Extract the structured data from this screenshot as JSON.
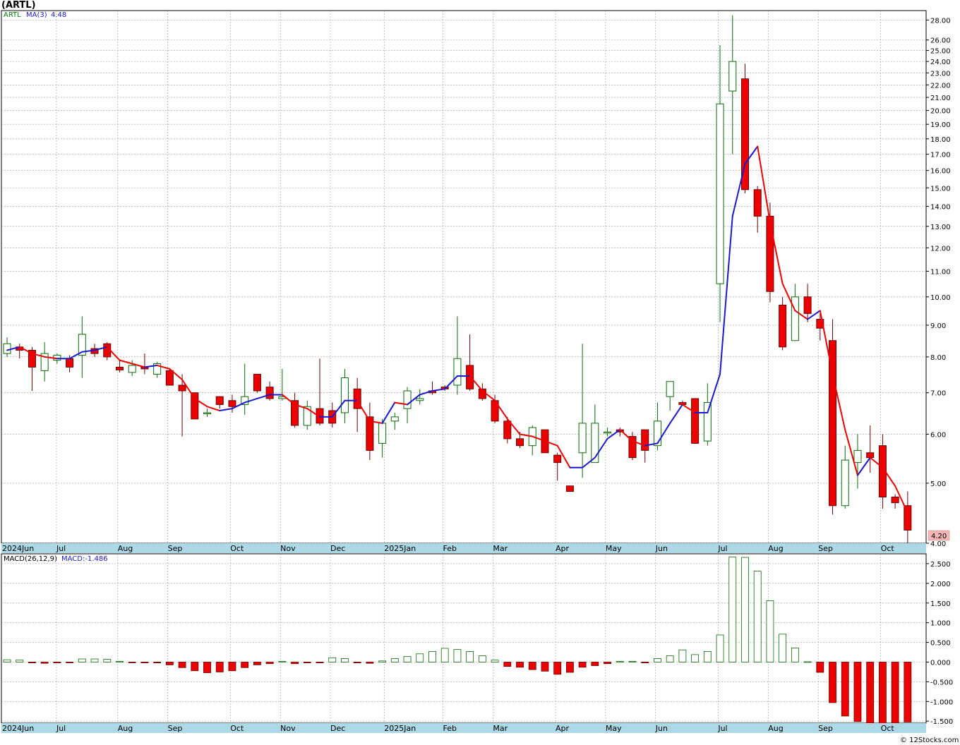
{
  "title": "(ARTL)",
  "legend": {
    "symbol": "ARTL",
    "ma_label": "MA(3)",
    "ma_value": "4.48",
    "macd_label": "MACD(26,12,9)",
    "macd_value_label": "MACD:-1.486"
  },
  "last_price_label": "4.20",
  "footer": "© 12Stocks.com",
  "colors": {
    "up": "#0a6a0a",
    "down_fill": "#ee0000",
    "down_border": "#660000",
    "ma_rising": "#1a1acc",
    "ma_falling": "#ee0000",
    "grid": "#999999",
    "month_bar": "#add8e6",
    "price_tag": "#f4b6b6"
  },
  "chart_data": [
    {
      "type": "candlestick",
      "series_name": "ARTL",
      "scale": "log",
      "ylim": [
        4.0,
        29.0
      ],
      "y_ticks": [
        4.0,
        5.0,
        6.0,
        7.0,
        8.0,
        9.0,
        10.0,
        11.0,
        12.0,
        13.0,
        14.0,
        15.0,
        16.0,
        17.0,
        18.0,
        19.0,
        20.0,
        21.0,
        22.0,
        23.0,
        24.0,
        25.0,
        26.0,
        28.0
      ],
      "y_tick_labels": [
        "4.00",
        "5.00",
        "6.00",
        "7.00",
        "8.00",
        "9.00",
        "10.00",
        "11.00",
        "12.00",
        "13.00",
        "14.00",
        "15.00",
        "16.00",
        "17.00",
        "18.00",
        "19.00",
        "20.00",
        "21.00",
        "22.00",
        "23.00",
        "24.00",
        "25.00",
        "26.00",
        "28.00"
      ],
      "x_labels": [
        {
          "label": "2024Jun",
          "week": 0
        },
        {
          "label": "Jul",
          "week": 4.4
        },
        {
          "label": "Aug",
          "week": 9.3
        },
        {
          "label": "Sep",
          "week": 13.3
        },
        {
          "label": "Oct",
          "week": 18.3
        },
        {
          "label": "Nov",
          "week": 22.3
        },
        {
          "label": "Dec",
          "week": 26.3
        },
        {
          "label": "2025Jan",
          "week": 30.6
        },
        {
          "label": "Feb",
          "week": 35.3
        },
        {
          "label": "Mar",
          "week": 39.3
        },
        {
          "label": "Apr",
          "week": 44.3
        },
        {
          "label": "May",
          "week": 48.3
        },
        {
          "label": "Jun",
          "week": 52.3
        },
        {
          "label": "Jul",
          "week": 57.3
        },
        {
          "label": "Aug",
          "week": 61.3
        },
        {
          "label": "Sep",
          "week": 65.3
        },
        {
          "label": "Oct",
          "week": 70.3
        }
      ],
      "ohlc": [
        [
          8.1,
          8.6,
          8.0,
          8.4
        ],
        [
          8.3,
          8.4,
          7.95,
          8.2
        ],
        [
          8.2,
          8.3,
          7.05,
          7.7
        ],
        [
          7.6,
          8.45,
          7.3,
          8.1
        ],
        [
          7.9,
          8.1,
          7.8,
          8.05
        ],
        [
          7.95,
          8.05,
          7.55,
          7.7
        ],
        [
          8.05,
          9.3,
          7.4,
          8.7
        ],
        [
          8.25,
          8.4,
          8.0,
          8.1
        ],
        [
          8.4,
          8.45,
          7.9,
          8.0
        ],
        [
          7.7,
          7.9,
          7.55,
          7.62
        ],
        [
          7.55,
          7.9,
          7.45,
          7.75
        ],
        [
          7.7,
          8.1,
          7.5,
          7.65
        ],
        [
          7.5,
          7.85,
          7.4,
          7.8
        ],
        [
          7.6,
          7.65,
          7.2,
          7.2
        ],
        [
          7.2,
          7.5,
          5.95,
          7.05
        ],
        [
          7.0,
          7.0,
          6.35,
          6.35
        ],
        [
          6.5,
          6.6,
          6.4,
          6.5
        ],
        [
          6.9,
          6.9,
          6.6,
          6.7
        ],
        [
          6.8,
          6.95,
          6.5,
          6.65
        ],
        [
          6.7,
          7.8,
          6.45,
          6.9
        ],
        [
          7.5,
          7.5,
          7.0,
          7.05
        ],
        [
          7.15,
          7.3,
          6.8,
          6.85
        ],
        [
          6.85,
          7.65,
          6.8,
          6.9
        ],
        [
          6.8,
          7.0,
          6.15,
          6.2
        ],
        [
          6.2,
          6.8,
          6.1,
          6.65
        ],
        [
          6.6,
          7.95,
          6.2,
          6.25
        ],
        [
          6.55,
          6.75,
          6.15,
          6.25
        ],
        [
          6.5,
          7.65,
          6.25,
          7.4
        ],
        [
          7.1,
          7.4,
          6.05,
          6.6
        ],
        [
          6.4,
          6.75,
          5.45,
          5.65
        ],
        [
          5.8,
          6.35,
          5.5,
          6.25
        ],
        [
          6.3,
          6.5,
          6.1,
          6.4
        ],
        [
          6.6,
          7.15,
          6.25,
          7.05
        ],
        [
          6.8,
          7.1,
          6.7,
          6.85
        ],
        [
          7.05,
          7.3,
          6.95,
          7.0
        ],
        [
          7.15,
          7.2,
          7.05,
          7.1
        ],
        [
          7.2,
          9.3,
          6.95,
          7.95
        ],
        [
          7.75,
          8.7,
          7.05,
          7.1
        ],
        [
          7.1,
          7.25,
          6.8,
          6.85
        ],
        [
          6.8,
          6.95,
          6.25,
          6.3
        ],
        [
          6.3,
          6.4,
          5.8,
          5.9
        ],
        [
          5.9,
          6.05,
          5.7,
          5.75
        ],
        [
          5.75,
          6.2,
          5.55,
          6.15
        ],
        [
          6.1,
          6.1,
          5.6,
          5.6
        ],
        [
          5.55,
          5.6,
          5.05,
          5.4
        ],
        [
          4.95,
          4.95,
          4.85,
          4.85
        ],
        [
          5.6,
          8.4,
          5.1,
          6.25
        ],
        [
          5.4,
          6.7,
          5.4,
          6.25
        ],
        [
          6.05,
          6.15,
          5.95,
          6.05
        ],
        [
          6.1,
          6.15,
          5.95,
          6.05
        ],
        [
          5.95,
          6.05,
          5.45,
          5.5
        ],
        [
          6.1,
          6.1,
          5.4,
          5.65
        ],
        [
          5.75,
          6.75,
          5.65,
          6.3
        ],
        [
          6.9,
          7.25,
          6.55,
          7.3
        ],
        [
          6.75,
          6.8,
          6.75,
          6.7
        ],
        [
          6.85,
          6.85,
          5.8,
          5.8
        ],
        [
          5.85,
          7.25,
          5.75,
          6.75
        ],
        [
          10.5,
          25.5,
          9.1,
          20.5
        ],
        [
          21.5,
          28.5,
          17.0,
          24.0
        ],
        [
          22.5,
          23.8,
          14.7,
          14.9
        ],
        [
          14.9,
          15.1,
          12.7,
          13.5
        ],
        [
          13.5,
          14.2,
          9.8,
          10.2
        ],
        [
          9.7,
          10.0,
          8.2,
          8.3
        ],
        [
          8.5,
          10.5,
          8.5,
          10.0
        ],
        [
          10.0,
          10.5,
          9.1,
          9.4
        ],
        [
          9.2,
          9.4,
          8.5,
          8.9
        ],
        [
          8.5,
          9.2,
          4.45,
          4.6
        ],
        [
          4.6,
          5.75,
          4.55,
          5.45
        ],
        [
          5.4,
          6.0,
          4.9,
          5.65
        ],
        [
          5.6,
          6.2,
          5.2,
          5.5
        ],
        [
          5.75,
          6.0,
          4.55,
          4.75
        ],
        [
          4.75,
          4.8,
          4.55,
          4.65
        ],
        [
          4.6,
          4.85,
          4.0,
          4.2
        ]
      ],
      "ma3": [
        8.2,
        8.3,
        8.1,
        8.0,
        7.95,
        7.95,
        8.15,
        8.2,
        8.3,
        7.9,
        7.8,
        7.7,
        7.75,
        7.65,
        7.35,
        6.85,
        6.65,
        6.55,
        6.6,
        6.75,
        6.85,
        6.95,
        6.95,
        6.7,
        6.6,
        6.4,
        6.4,
        6.8,
        6.8,
        6.3,
        6.25,
        6.75,
        6.7,
        6.95,
        7.05,
        7.1,
        7.45,
        7.45,
        7.05,
        6.8,
        6.35,
        6.0,
        5.95,
        5.85,
        5.75,
        5.3,
        5.3,
        5.5,
        5.9,
        6.1,
        5.85,
        5.75,
        5.8,
        6.25,
        6.7,
        6.5,
        6.5,
        7.5,
        13.5,
        16.4,
        17.5,
        13.2,
        10.5,
        9.5,
        9.2,
        9.5,
        7.5,
        6.1,
        5.15,
        5.5,
        5.3,
        4.95,
        4.48
      ]
    },
    {
      "type": "bar",
      "series_name": "MACD(26,12,9)",
      "ylim": [
        -1.55,
        2.75
      ],
      "y_ticks": [
        -1.5,
        -1.0,
        -0.5,
        0.0,
        0.5,
        1.0,
        1.5,
        2.0,
        2.5
      ],
      "y_tick_labels": [
        "-1.500",
        "-1.000",
        "-0.500",
        "0.000",
        "0.500",
        "1.000",
        "1.500",
        "2.000",
        "2.500"
      ],
      "values": [
        0.06,
        0.05,
        -0.02,
        -0.03,
        -0.02,
        -0.01,
        0.08,
        0.08,
        0.07,
        0.02,
        -0.01,
        -0.02,
        -0.02,
        -0.07,
        -0.14,
        -0.22,
        -0.27,
        -0.25,
        -0.22,
        -0.14,
        -0.07,
        -0.04,
        0.02,
        -0.04,
        -0.02,
        -0.02,
        0.11,
        0.09,
        -0.02,
        -0.03,
        0.03,
        0.09,
        0.14,
        0.21,
        0.27,
        0.35,
        0.32,
        0.27,
        0.16,
        0.05,
        -0.11,
        -0.13,
        -0.19,
        -0.23,
        -0.31,
        -0.26,
        -0.13,
        -0.09,
        -0.04,
        0.02,
        0.02,
        -0.02,
        0.09,
        0.16,
        0.31,
        0.19,
        0.27,
        0.69,
        2.67,
        2.66,
        2.31,
        1.56,
        0.71,
        0.36,
        0.01,
        -0.26,
        -1.03,
        -1.37,
        -1.51,
        -1.55,
        -1.58,
        -1.55,
        -1.52
      ]
    }
  ]
}
